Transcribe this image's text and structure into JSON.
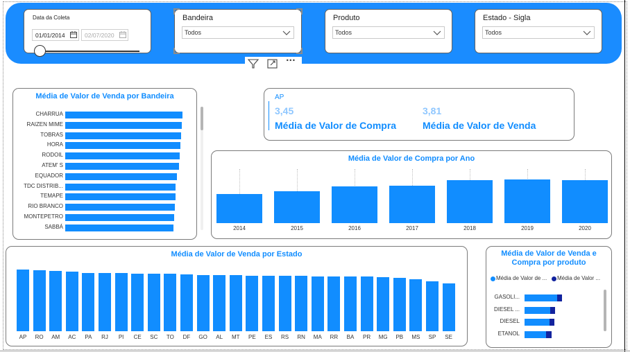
{
  "filters": {
    "date": {
      "title": "Data da Coleta",
      "start": "01/01/2014",
      "end": "02/07/2020",
      "slider_fraction": 0.0
    },
    "bandeira": {
      "title": "Bandeira",
      "value": "Todos"
    },
    "produto": {
      "title": "Produto",
      "value": "Todos"
    },
    "estado": {
      "title": "Estado - Sigla",
      "value": "Todos"
    }
  },
  "toolbar": {
    "icons": [
      "filter-icon",
      "focus-mode-icon",
      "more-options-icon"
    ],
    "more_label": "···"
  },
  "colors": {
    "accent": "#118dff",
    "filterbar": "#1a8cff",
    "dark_series": "#12239e",
    "kpi_value": "#8fc7ff"
  },
  "kpi": {
    "state_label": "AP",
    "compra_value": "3,45",
    "compra_caption": "Média de Valor de Compra",
    "venda_value": "3,81",
    "venda_caption": "Média de Valor de Venda"
  },
  "chart_data": [
    {
      "type": "bar",
      "orientation": "horizontal",
      "title": "Média de Valor de Venda por Bandeira",
      "categories": [
        "CHARRUA",
        "RAIZEN MIME",
        "TOBRAS",
        "HORA",
        "RODOIL",
        "ATEM' S",
        "EQUADOR",
        "TDC DISTRIB...",
        "TEMAPE",
        "RIO BRANCO",
        "MONTEPETRO",
        "SABBÁ"
      ],
      "values": [
        3.72,
        3.68,
        3.66,
        3.64,
        3.62,
        3.6,
        3.54,
        3.5,
        3.49,
        3.47,
        3.45,
        3.42
      ],
      "xlim": [
        0,
        3.8
      ]
    },
    {
      "type": "bar",
      "title": "Média de Valor de Compra por Ano",
      "categories": [
        "2014",
        "2015",
        "2016",
        "2017",
        "2018",
        "2019",
        "2020"
      ],
      "values": [
        2.45,
        2.65,
        3.05,
        3.1,
        3.6,
        3.65,
        3.6
      ],
      "ylim": [
        0,
        4.5
      ]
    },
    {
      "type": "bar",
      "title": "Média de Valor de Venda por Estado",
      "categories": [
        "AP",
        "RO",
        "AM",
        "AC",
        "PA",
        "RJ",
        "PI",
        "CE",
        "SC",
        "TO",
        "DF",
        "GO",
        "AL",
        "MT",
        "PE",
        "ES",
        "RS",
        "RN",
        "MA",
        "RR",
        "BA",
        "PR",
        "MG",
        "PB",
        "MS",
        "SP",
        "SE"
      ],
      "values": [
        3.81,
        3.78,
        3.72,
        3.7,
        3.62,
        3.6,
        3.59,
        3.58,
        3.57,
        3.56,
        3.5,
        3.49,
        3.48,
        3.47,
        3.45,
        3.44,
        3.42,
        3.41,
        3.4,
        3.39,
        3.38,
        3.37,
        3.35,
        3.3,
        3.22,
        3.1,
        2.98
      ],
      "ylim": [
        0,
        3.9
      ]
    },
    {
      "type": "bar",
      "orientation": "horizontal",
      "stacked": true,
      "title": "Média de Valor de Venda e Compra por produto",
      "categories": [
        "GASOLI...",
        "DIESEL ...",
        "DIESEL",
        "ETANOL"
      ],
      "series": [
        {
          "name": "Média de Valor de ...",
          "values": [
            4.6,
            3.6,
            3.5,
            3.0
          ]
        },
        {
          "name": "Média de Valor ...",
          "values": [
            5.3,
            4.3,
            4.2,
            3.8
          ]
        }
      ],
      "legend": "top",
      "xlim": [
        0,
        10
      ]
    }
  ]
}
